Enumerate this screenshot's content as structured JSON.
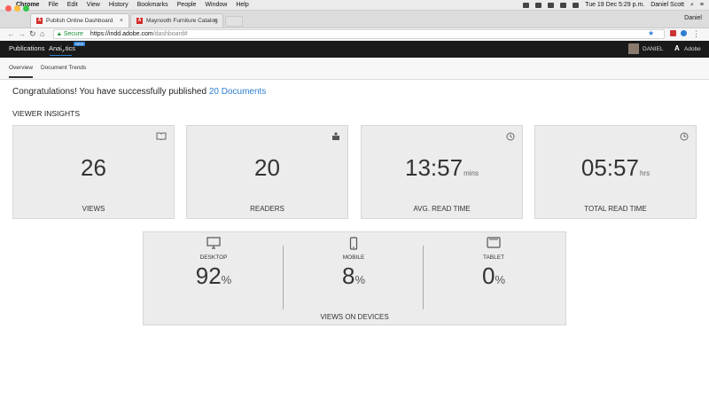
{
  "menubar": {
    "app": "Chrome",
    "items": [
      "File",
      "Edit",
      "View",
      "History",
      "Bookmarks",
      "People",
      "Window",
      "Help"
    ],
    "clock": "Tue 19 Dec  5:29 p.m.",
    "user": "Daniel Scott"
  },
  "tabs": [
    {
      "label": "Publish Online Dashboard",
      "active": true
    },
    {
      "label": "Maynooth Furniture Catalog",
      "active": false
    }
  ],
  "profile_name": "Daniel",
  "address": {
    "secure_label": "Secure",
    "host": "https://indd.adobe.com",
    "path": "/dashboard#"
  },
  "app_nav": {
    "publications": "Publications",
    "analytics": "Analytics",
    "new_badge": "NEW",
    "user": "DANIEL",
    "adobe": "Adobe"
  },
  "sub_tabs": [
    "Overview",
    "Document Trends"
  ],
  "headline": {
    "prefix": "Congratulations! You have successfully published",
    "link": "20 Documents"
  },
  "section_title": "VIEWER INSIGHTS",
  "insights": [
    {
      "value": "26",
      "unit": "",
      "label": "VIEWS",
      "icon": "book-icon"
    },
    {
      "value": "20",
      "unit": "",
      "label": "READERS",
      "icon": "reader-icon"
    },
    {
      "value": "13:57",
      "unit": "mins",
      "label": "AVG. READ TIME",
      "icon": "history-icon"
    },
    {
      "value": "05:57",
      "unit": "hrs",
      "label": "TOTAL READ TIME",
      "icon": "clock-icon"
    }
  ],
  "devices": {
    "label": "VIEWS ON DEVICES",
    "items": [
      {
        "label": "DESKTOP",
        "value": "92",
        "unit": "%",
        "icon": "desktop-icon"
      },
      {
        "label": "MOBILE",
        "value": "8",
        "unit": "%",
        "icon": "mobile-icon"
      },
      {
        "label": "TABLET",
        "value": "0",
        "unit": "%",
        "icon": "tablet-icon"
      }
    ]
  },
  "colors": {
    "accent": "#2d7fcf",
    "header_bg": "#1a1a1a",
    "card_bg": "#ececec",
    "secure": "#1a8a34"
  }
}
